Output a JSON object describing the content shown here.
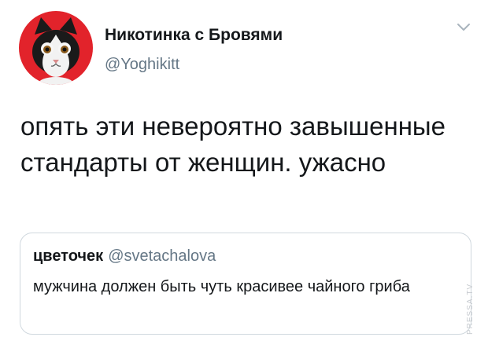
{
  "tweet": {
    "author_name": "Никотинка с Бровями",
    "author_handle": "@Yoghikitt",
    "avatar_icon": "cat-avatar-icon",
    "menu_icon": "chevron-down-icon",
    "text": "опять эти невероятно завышенные стандарты от женщин. ужасно"
  },
  "quoted_tweet": {
    "author_name": "цветочек",
    "author_handle": "@svetachalova",
    "text": "мужчина должен быть чуть красивее чайного гриба"
  },
  "watermark": {
    "text": "PRESSA.TV"
  },
  "colors": {
    "avatar_background": "#e2232b",
    "secondary_text": "#657786",
    "primary_text": "#14171a",
    "border": "#d0d8de"
  }
}
